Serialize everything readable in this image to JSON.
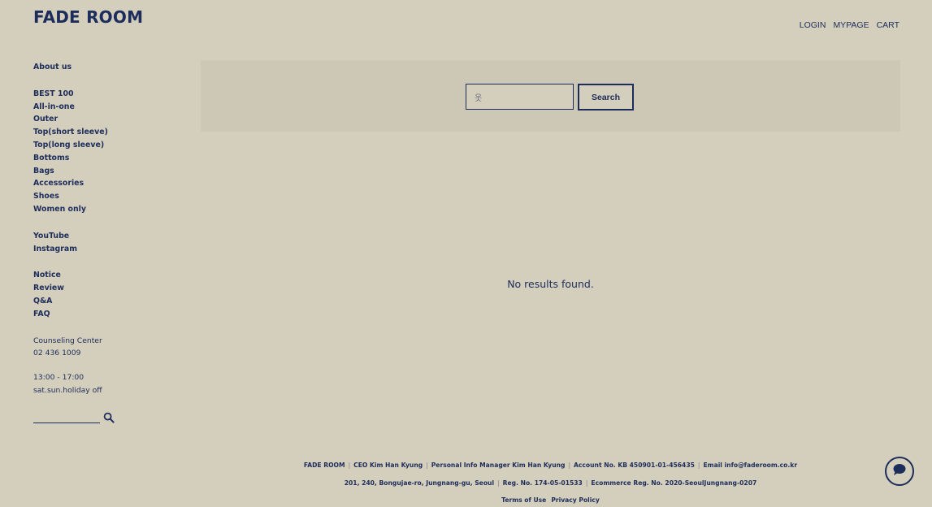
{
  "brand": {
    "logo": "FADE ROOM"
  },
  "topnav": {
    "login": "LOGIN",
    "mypage": "MYPAGE",
    "cart": "CART"
  },
  "sidebar": {
    "about": "About us",
    "categories": [
      "BEST 100",
      "All-in-one",
      "Outer",
      "Top(short sleeve)",
      "Top(long sleeve)",
      "Bottoms",
      "Bags",
      "Accessories",
      "Shoes",
      "Women only"
    ],
    "social": [
      "YouTube",
      "Instagram"
    ],
    "community": [
      "Notice",
      "Review",
      "Q&A",
      "FAQ"
    ],
    "counseling_label": "Counseling Center",
    "phone": "02 436 1009",
    "hours": "13:00 - 17:00",
    "off_days": "sat.sun.holiday off",
    "search_value": ""
  },
  "search": {
    "query": "옷",
    "button": "Search"
  },
  "results": {
    "message": "No results found."
  },
  "footer": {
    "row1": [
      "FADE ROOM",
      "CEO Kim Han Kyung",
      "Personal Info Manager Kim Han Kyung",
      "Account No. KB 450901-01-456435",
      "Email info@faderoom.co.kr"
    ],
    "row2": [
      "201, 240, Bongujae-ro, Jungnang-gu, Seoul",
      "Reg. No. 174-05-01533",
      "Ecommerce Reg. No. 2020-SeoulJungnang-0207"
    ],
    "terms": "Terms of Use",
    "privacy": "Privacy Policy",
    "separator": "|"
  },
  "icons": {
    "sidebar_search": "search-icon",
    "chat": "chat-bubble-icon"
  },
  "colors": {
    "background": "#d4cebc",
    "panel": "#cdc7b5",
    "accent": "#1d2d5b"
  }
}
